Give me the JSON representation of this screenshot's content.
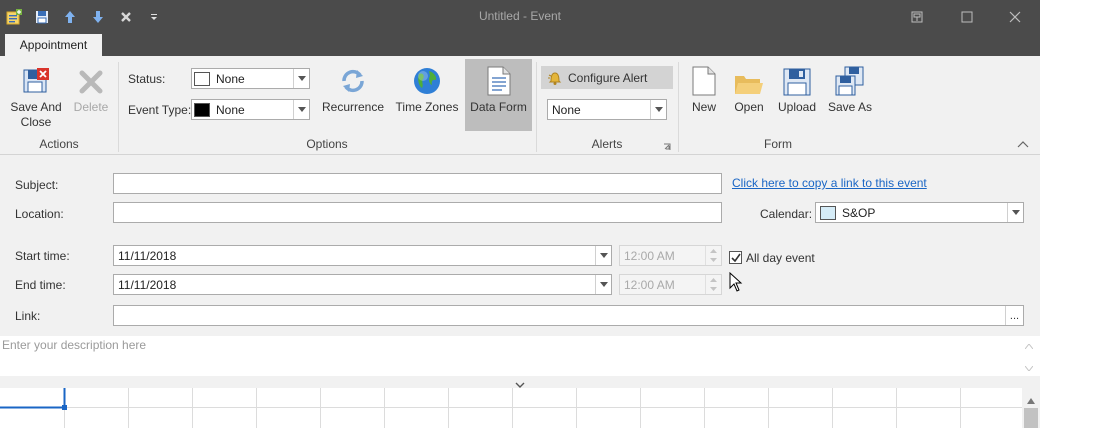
{
  "window": {
    "title": "Untitled - Event",
    "titlebar_color": "#4b4b4b"
  },
  "qat": {
    "icons": [
      "app-icon",
      "save-icon",
      "up-arrow-icon",
      "down-arrow-icon",
      "close-x-icon",
      "customize-dropdown-icon"
    ]
  },
  "ribbon": {
    "tab": "Appointment",
    "actions": {
      "save_and_close": "Save And Close",
      "delete": "Delete",
      "group": "Actions"
    },
    "options": {
      "status_label": "Status:",
      "status_value": "None",
      "event_type_label": "Event Type:",
      "event_type_value": "None",
      "recurrence": "Recurrence",
      "time_zones": "Time Zones",
      "data_form": "Data Form",
      "group": "Options"
    },
    "alerts": {
      "configure_alert": "Configure Alert",
      "alert_value": "None",
      "group": "Alerts"
    },
    "form": {
      "new": "New",
      "open": "Open",
      "upload": "Upload",
      "save_as": "Save As",
      "group": "Form"
    }
  },
  "form": {
    "subject_label": "Subject:",
    "subject_value": "",
    "copy_link": "Click here to copy a link to this event",
    "location_label": "Location:",
    "location_value": "",
    "calendar_label": "Calendar:",
    "calendar_value": "S&OP",
    "calendar_color": "#d5ecf7",
    "start_label": "Start time:",
    "start_date": "11/11/2018",
    "start_time": "12:00 AM",
    "end_label": "End time:",
    "end_date": "11/11/2018",
    "end_time": "12:00 AM",
    "all_day_label": "All day event",
    "all_day_checked": true,
    "link_label": "Link:",
    "link_value": "",
    "link_browse": "..."
  },
  "description": {
    "placeholder": "Enter your description here"
  },
  "colors": {
    "link": "#1a66c5",
    "active_button": "#bdbdbd",
    "grid_selection": "#1a66c5"
  }
}
